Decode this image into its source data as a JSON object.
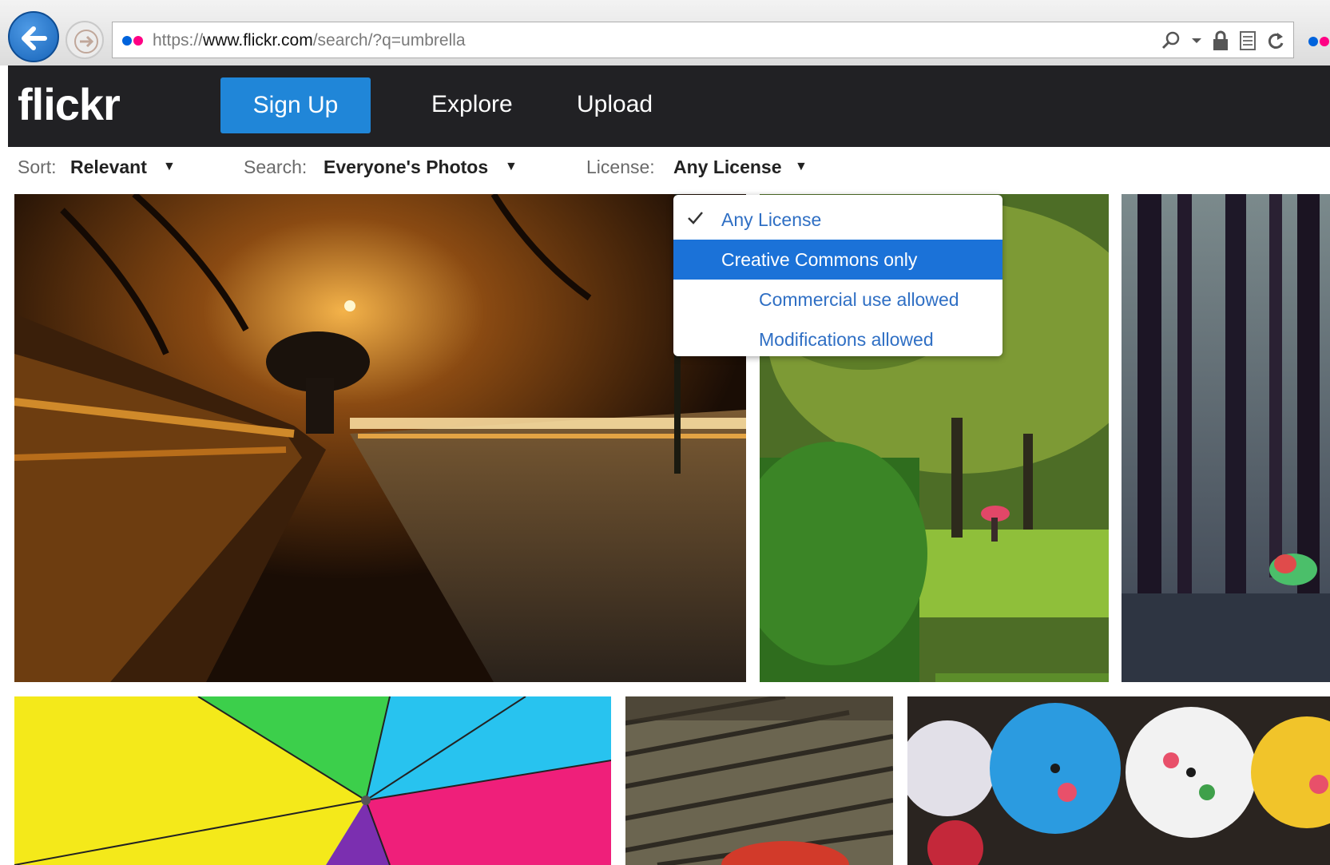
{
  "browser": {
    "url_scheme": "https://",
    "url_host": "www.flickr.com",
    "url_path": "/search/?q=umbrella",
    "accent": "#1663b8"
  },
  "brand": {
    "dot_blue": "#0063dc",
    "dot_pink": "#ff0084"
  },
  "header": {
    "logo": "flickr",
    "signup_label": "Sign Up",
    "nav": [
      "Explore",
      "Upload"
    ],
    "accent": "#2086d8"
  },
  "filters": {
    "sort_label": "Sort:",
    "sort_value": "Relevant",
    "search_label": "Search:",
    "search_value": "Everyone's Photos",
    "license_label": "License:",
    "license_value": "Any License"
  },
  "license_menu": {
    "items": [
      "Any License",
      "Creative Commons only",
      "Commercial use allowed",
      "Modifications allowed"
    ],
    "checked": "Any License",
    "highlighted": "Creative Commons only"
  },
  "photos": [
    {
      "subject": "night park bench with umbrella"
    },
    {
      "subject": "green park with red umbrella"
    },
    {
      "subject": "dark forest with colorful umbrella"
    },
    {
      "subject": "rainbow umbrella close-up"
    },
    {
      "subject": "wet wooden boardwalk"
    },
    {
      "subject": "painted paper parasols"
    }
  ]
}
